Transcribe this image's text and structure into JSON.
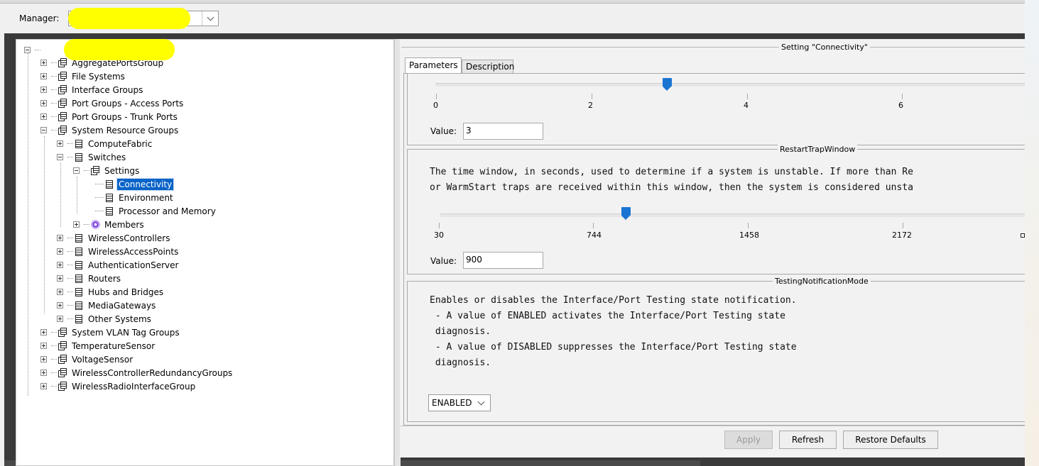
{
  "manager": {
    "label": "Manager:",
    "value": ""
  },
  "tree": {
    "root_label": "",
    "items": [
      {
        "label": "AggregatePortsGroup"
      },
      {
        "label": "File Systems"
      },
      {
        "label": "Interface Groups"
      },
      {
        "label": "Port Groups - Access Ports"
      },
      {
        "label": "Port Groups - Trunk Ports"
      },
      {
        "label": "System Resource Groups"
      },
      {
        "label": "ComputeFabric"
      },
      {
        "label": "Switches"
      },
      {
        "label": "Settings"
      },
      {
        "label": "Connectivity"
      },
      {
        "label": "Environment"
      },
      {
        "label": "Processor and Memory"
      },
      {
        "label": "Members"
      },
      {
        "label": "WirelessControllers"
      },
      {
        "label": "WirelessAccessPoints"
      },
      {
        "label": "AuthenticationServer"
      },
      {
        "label": "Routers"
      },
      {
        "label": "Hubs and Bridges"
      },
      {
        "label": "MediaGateways"
      },
      {
        "label": "Other Systems"
      },
      {
        "label": "System VLAN Tag Groups"
      },
      {
        "label": "TemperatureSensor"
      },
      {
        "label": "VoltageSensor"
      },
      {
        "label": "WirelessControllerRedundancyGroups"
      },
      {
        "label": "WirelessRadioInterfaceGroup"
      }
    ]
  },
  "setting": {
    "title": "Setting \"Connectivity\"",
    "tabs": {
      "parameters": "Parameters",
      "description": "Description"
    }
  },
  "param1": {
    "ticks": [
      "0",
      "2",
      "4",
      "6"
    ],
    "value_label": "Value:",
    "value": "3"
  },
  "param2": {
    "name": "RestartTrapWindow",
    "description_line1": "The time window, in seconds, used to determine if a system is unstable. If more than Re",
    "description_line2": "or WarmStart traps are received within this window, then the system is considered unsta",
    "ticks": [
      "30",
      "744",
      "1458",
      "2172"
    ],
    "value_label": "Value:",
    "value": "900"
  },
  "param3": {
    "name": "TestingNotificationMode",
    "description_line1": "Enables or disables the Interface/Port Testing state notification.",
    "description_line2": " - A value of ENABLED activates the Interface/Port Testing state",
    "description_line3": " diagnosis.",
    "description_line4": " - A value of DISABLED suppresses the Interface/Port Testing state",
    "description_line5": " diagnosis.",
    "selected": "ENABLED"
  },
  "buttons": {
    "apply": "Apply",
    "refresh": "Refresh",
    "restore": "Restore Defaults"
  },
  "colors": {
    "selection": "#0a64c8",
    "slider_thumb": "#1a74d2",
    "redaction": "#ffff00"
  },
  "icons": [
    "expand-icon",
    "collapse-icon",
    "group-icon",
    "document-icon",
    "members-icon",
    "chevron-down-icon"
  ]
}
